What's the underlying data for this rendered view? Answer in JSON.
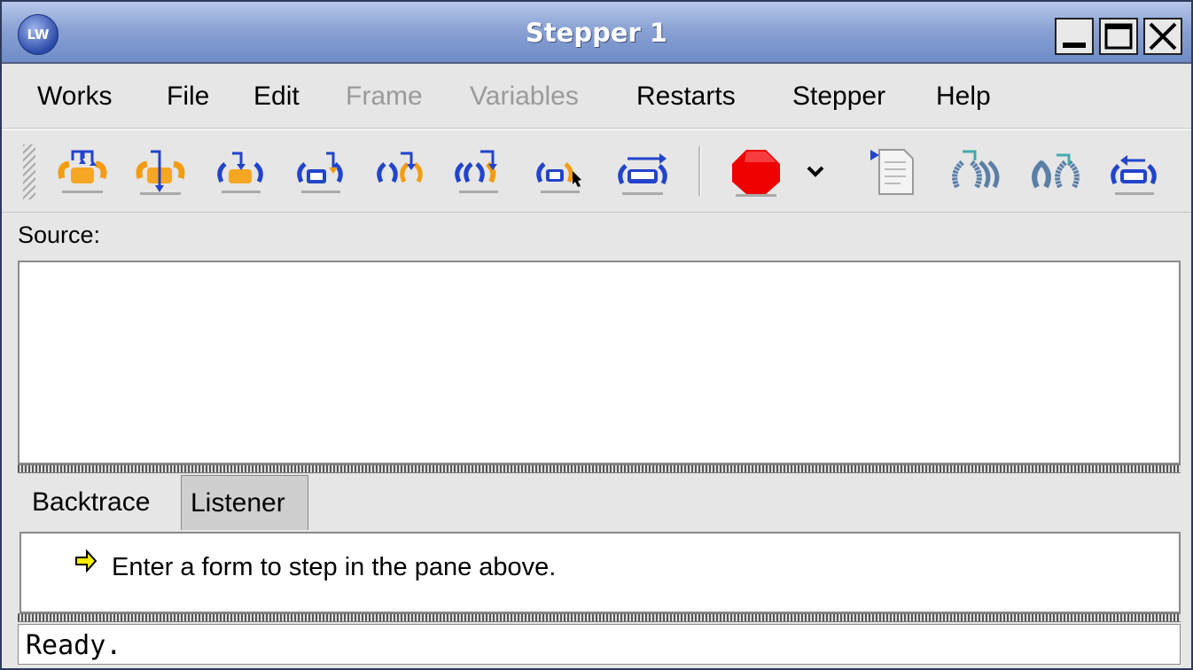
{
  "window": {
    "title": "Stepper 1",
    "logo_text": "LW"
  },
  "menubar": {
    "items": [
      {
        "label": "Works",
        "enabled": true
      },
      {
        "label": "File",
        "enabled": true
      },
      {
        "label": "Edit",
        "enabled": true
      },
      {
        "label": "Frame",
        "enabled": false
      },
      {
        "label": "Variables",
        "enabled": false
      },
      {
        "label": "Restarts",
        "enabled": true
      },
      {
        "label": "Stepper",
        "enabled": true
      },
      {
        "label": "Help",
        "enabled": true
      }
    ]
  },
  "toolbar": {
    "buttons": [
      {
        "name": "step-icon"
      },
      {
        "name": "step-into-icon"
      },
      {
        "name": "step-to-call-icon"
      },
      {
        "name": "step-to-value-icon"
      },
      {
        "name": "step-next-icon"
      },
      {
        "name": "step-through-icon"
      },
      {
        "name": "step-to-cursor-icon"
      },
      {
        "name": "continue-icon"
      },
      {
        "name": "stop-icon"
      },
      {
        "name": "dropdown-chevron-icon"
      },
      {
        "name": "show-source-icon"
      },
      {
        "name": "undo-step-icon"
      },
      {
        "name": "restart-icon"
      },
      {
        "name": "return-icon"
      }
    ]
  },
  "source": {
    "label": "Source:"
  },
  "tabs": [
    {
      "label": "Backtrace",
      "active": true
    },
    {
      "label": "Listener",
      "active": false
    }
  ],
  "backtrace": {
    "message": "Enter a form to step in the pane above."
  },
  "status": {
    "text": "Ready."
  },
  "colors": {
    "title_bar": "#8aa2d4",
    "stop": "#ee0000",
    "accent_orange": "#f39c12",
    "accent_blue": "#2244cc"
  }
}
